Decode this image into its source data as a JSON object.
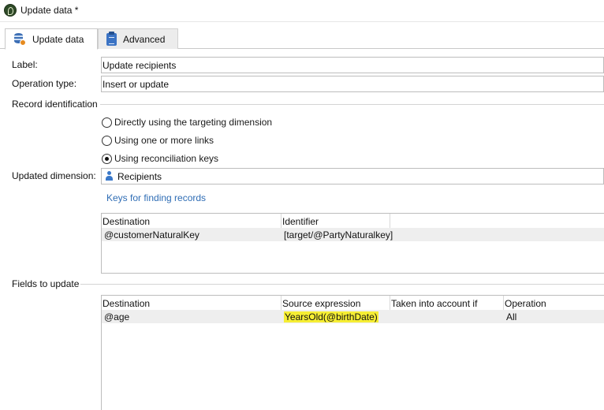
{
  "window": {
    "title": "Update data *"
  },
  "tabs": [
    {
      "label": "Update data",
      "icon": "database-update-icon",
      "active": true
    },
    {
      "label": "Advanced",
      "icon": "clipboard-icon",
      "active": false
    }
  ],
  "form": {
    "label_label": "Label:",
    "label_value": "Update recipients",
    "operation_type_label": "Operation type:",
    "operation_type_value": "Insert or update",
    "record_identification_label": "Record identification",
    "radios": [
      {
        "label": "Directly using the targeting dimension",
        "selected": false
      },
      {
        "label": "Using one or more links",
        "selected": false
      },
      {
        "label": "Using reconciliation keys",
        "selected": true
      }
    ],
    "updated_dimension_label": "Updated dimension:",
    "updated_dimension_value": "Recipients",
    "keys_link": "Keys for finding records"
  },
  "keys_table": {
    "columns": [
      "Destination",
      "Identifier"
    ],
    "rows": [
      [
        "@customerNaturalKey",
        "[target/@PartyNaturalkey]"
      ]
    ]
  },
  "fields_section": {
    "label": "Fields to update"
  },
  "fields_table": {
    "columns": [
      "Destination",
      "Source expression",
      "Taken into account if",
      "Operation"
    ],
    "rows": [
      [
        "@age",
        "YearsOld(@birthDate)",
        "",
        "All"
      ]
    ]
  },
  "colors": {
    "accent_link": "#2f6db5",
    "highlight": "#f6ee34"
  }
}
